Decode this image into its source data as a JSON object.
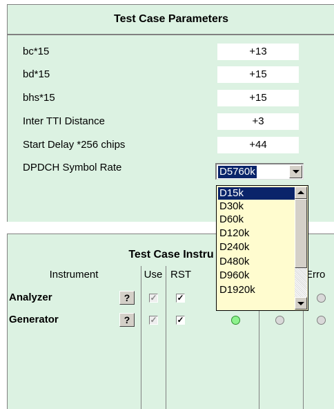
{
  "params": {
    "title": "Test Case Parameters",
    "rows": [
      {
        "label": "bc*15",
        "value": "+13"
      },
      {
        "label": "bd*15",
        "value": "+15"
      },
      {
        "label": "bhs*15",
        "value": "+15"
      },
      {
        "label": "Inter TTI Distance",
        "value": "+3"
      },
      {
        "label": "Start Delay *256 chips",
        "value": "+44"
      }
    ],
    "symbol_rate": {
      "label": "DPDCH Symbol Rate",
      "selected": "D5760k",
      "options": [
        "D15k",
        "D30k",
        "D60k",
        "D120k",
        "D240k",
        "D480k",
        "D960k",
        "D1920k"
      ],
      "highlighted": "D15k"
    }
  },
  "instruments": {
    "title": "Test Case Instru",
    "columns": {
      "instrument": "Instrument",
      "use": "Use",
      "rst": "RST",
      "error": "Erro"
    },
    "rows": [
      {
        "name": "Analyzer",
        "help": "?",
        "use": "✓",
        "rst": "✓"
      },
      {
        "name": "Generator",
        "help": "?",
        "use": "✓",
        "rst": "✓"
      }
    ]
  },
  "colors": {
    "panel": "#dcf2e2",
    "dropdown": "#fffccf",
    "selection": "#0a246a",
    "radio_on": "#8df28d"
  }
}
